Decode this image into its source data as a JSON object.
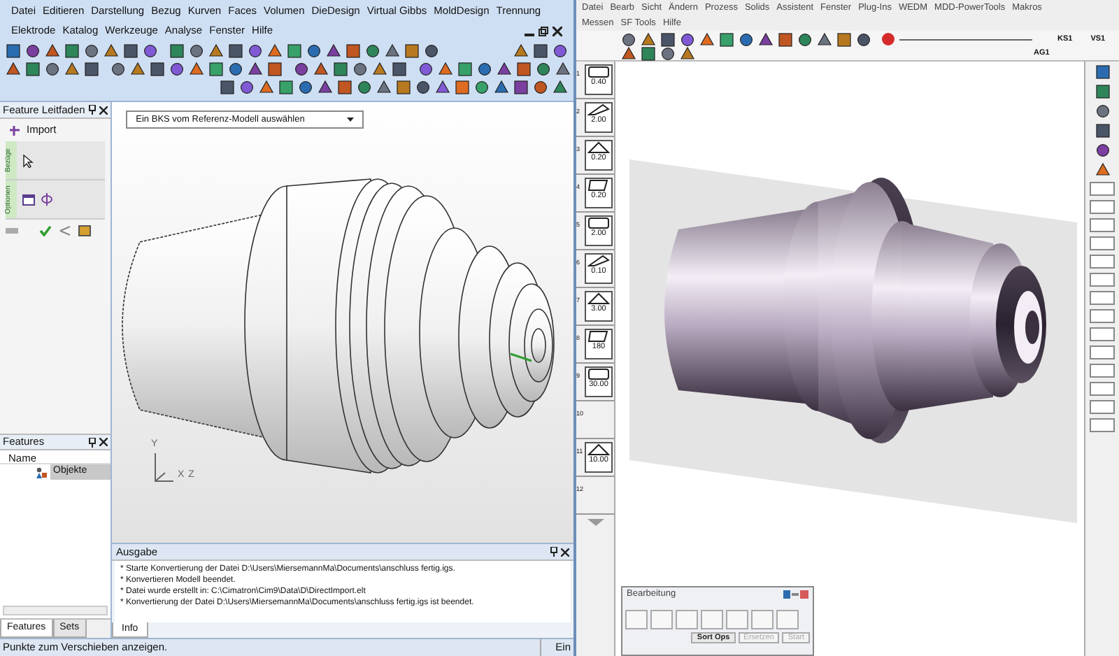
{
  "left_window": {
    "menu_rows": [
      [
        "Datei",
        "Editieren",
        "Darstellung",
        "Bezug",
        "Kurven",
        "Faces",
        "Volumen",
        "DieDesign",
        "Virtual Gibbs",
        "MoldDesign",
        "Trennung"
      ],
      [
        "Elektrode",
        "Katalog",
        "Werkzeuge",
        "Analyse",
        "Fenster",
        "Hilfe"
      ]
    ],
    "feature_guide": {
      "title": "Feature Leitfaden",
      "item": "Import",
      "sections": [
        "Bezüge",
        "Optionen"
      ]
    },
    "features_panel": {
      "title": "Features",
      "column": "Name",
      "items": [
        {
          "label": "Objekte",
          "selected": true
        }
      ]
    },
    "bottom_tabs": [
      {
        "label": "Features",
        "selected": true
      },
      {
        "label": "Sets",
        "selected": false
      }
    ],
    "viewport": {
      "dropdown": "Ein BKS vom Referenz-Modell auswählen",
      "axes": [
        "Y",
        "X",
        "Z"
      ]
    },
    "output": {
      "title": "Ausgabe",
      "lines": [
        "* Starte Konvertierung der Datei D:\\Users\\MiersemannMa\\Documents\\anschluss fertig.igs.",
        "* Konvertieren Modell beendet.",
        "* Datei wurde erstellt in: C:\\Cimatron\\Cim9\\Data\\D\\DirectImport.elt",
        "* Konvertierung der Datei D:\\Users\\MiersemannMa\\Documents\\anschluss fertig.igs ist beendet."
      ],
      "tabs": [
        {
          "label": "Info",
          "selected": true
        }
      ]
    },
    "status_bar": {
      "message": "Punkte zum Verschieben anzeigen.",
      "indicator": "Ein"
    }
  },
  "right_window": {
    "menu_rows": [
      [
        "Datei",
        "Bearb",
        "Sicht",
        "Ändern",
        "Prozess",
        "Solids",
        "Assistent",
        "Fenster",
        "Plug-Ins",
        "WEDM",
        "MDD-PowerTools",
        "Makros"
      ],
      [
        "Messen",
        "SF Tools",
        "Hilfe"
      ]
    ],
    "toolbar_labels": [
      "KS1",
      "AG1",
      "VS1"
    ],
    "tools": [
      {
        "number": "1",
        "value": "0.40"
      },
      {
        "number": "2",
        "value": "2.00"
      },
      {
        "number": "3",
        "value": "0.20"
      },
      {
        "number": "4",
        "value": "0.20"
      },
      {
        "number": "5",
        "value": "2.00"
      },
      {
        "number": "6",
        "value": "0.10"
      },
      {
        "number": "7",
        "value": "3.00"
      },
      {
        "number": "8",
        "value": "180"
      },
      {
        "number": "9",
        "value": "30.00"
      },
      {
        "number": "10"
      },
      {
        "number": "11",
        "value": "10.00"
      },
      {
        "number": "12"
      }
    ],
    "machining_panel": {
      "title": "Bearbeitung",
      "buttons": [
        {
          "label": "Sort Ops",
          "disabled": false
        },
        {
          "label": "Ersetzen",
          "disabled": true
        },
        {
          "label": "Start",
          "disabled": true
        }
      ]
    }
  }
}
